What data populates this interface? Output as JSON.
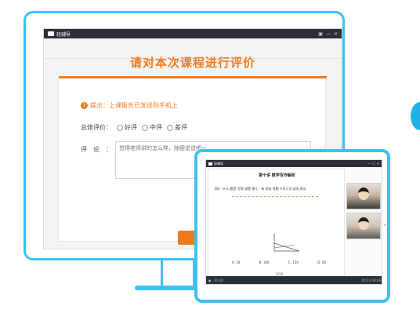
{
  "monitor": {
    "app_name": "轻辅导",
    "window_controls": [
      "▣",
      "—",
      "✕"
    ]
  },
  "evaluation": {
    "title": "请对本次课程进行评价",
    "tip_icon": "!",
    "tip_label": "提示：",
    "tip_text": "上课报告已发送到手机上",
    "rating_label": "总体评价：",
    "options": [
      "好评",
      "中评",
      "差评"
    ],
    "comment_label": "评论：",
    "comment_placeholder": "觉得老师讲的怎么样，随便说说吧~"
  },
  "tablet": {
    "app_name": "轻辅导",
    "window_controls": [
      "—",
      "□",
      "✕"
    ],
    "lesson_title": "第十讲  数学写作解析",
    "question": "例2 · 什么 题目 写得 清楚 第七 · 有 如何 答题 A B C D 选项 表示",
    "answers": [
      "A. 10",
      "B. 100",
      "C. 150",
      "D. 50"
    ],
    "page": "2/10",
    "bottom_left": "01:00",
    "bottom_right": "00:23:08:09"
  },
  "colors": {
    "accent": "#f07a1c",
    "device_frame": "#3cc2f0",
    "titlebar": "#2b2f36"
  }
}
